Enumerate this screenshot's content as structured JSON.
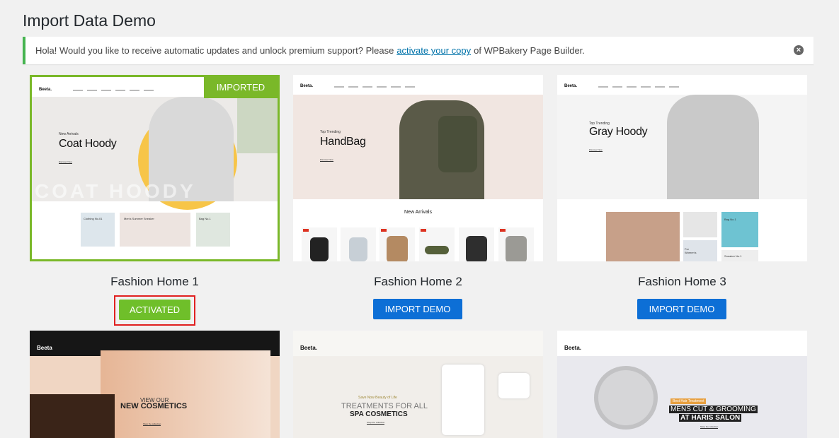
{
  "page": {
    "title": "Import Data Demo"
  },
  "notice": {
    "text_before": "Hola! Would you like to receive automatic updates and unlock premium support? Please",
    "link_text": "activate your copy",
    "text_after": "of WPBakery Page Builder.",
    "close_icon": "close-icon"
  },
  "colors": {
    "activated": "#6fbf2a",
    "import": "#0d6fd6",
    "imported_badge": "#7ab829",
    "highlight": "#e02020"
  },
  "demos": [
    {
      "title": "Fashion Home 1",
      "badge": "IMPORTED",
      "button": "ACTIVATED",
      "logo": "Beeta.",
      "hero_sub": "New Arrivals",
      "hero_title": "Coat Hoody",
      "hero_link": "Discover Now",
      "hero_bg_text": "COAT HOODY",
      "promos": [
        "Clothing No.01",
        "Men's Summer Sneaker",
        "Bag No.1"
      ]
    },
    {
      "title": "Fashion Home 2",
      "button": "IMPORT DEMO",
      "logo": "Beeta.",
      "hero_sub": "Top Trending",
      "hero_title": "HandBag",
      "hero_link": "Discover Now",
      "section": "New Arrivals"
    },
    {
      "title": "Fashion Home 3",
      "button": "IMPORT DEMO",
      "logo": "Beeta.",
      "hero_sub": "Top Trending",
      "hero_title": "Gray Hoody",
      "hero_link": "Discover Now",
      "promos": [
        "For Women's",
        "Bag No.1",
        "Sneaker No.1"
      ]
    },
    {
      "logo": "Beeta",
      "hero_sub": "VIEW OUR",
      "hero_title": "NEW COSMETICS",
      "hero_link": "Shop the collection"
    },
    {
      "logo": "Beeta.",
      "hero_sub": "Save Now Beauty of Life",
      "hero_line1": "TREATMENTS FOR ALL",
      "hero_title": "SPA COSMETICS",
      "hero_link": "Shop the collection"
    },
    {
      "logo": "Beeta.",
      "hero_sub": "Best Hair Treatment",
      "hero_line1": "MENS CUT & GROOMING",
      "hero_title": "AT HARIS SALON",
      "hero_link": "Shop the collection"
    }
  ]
}
